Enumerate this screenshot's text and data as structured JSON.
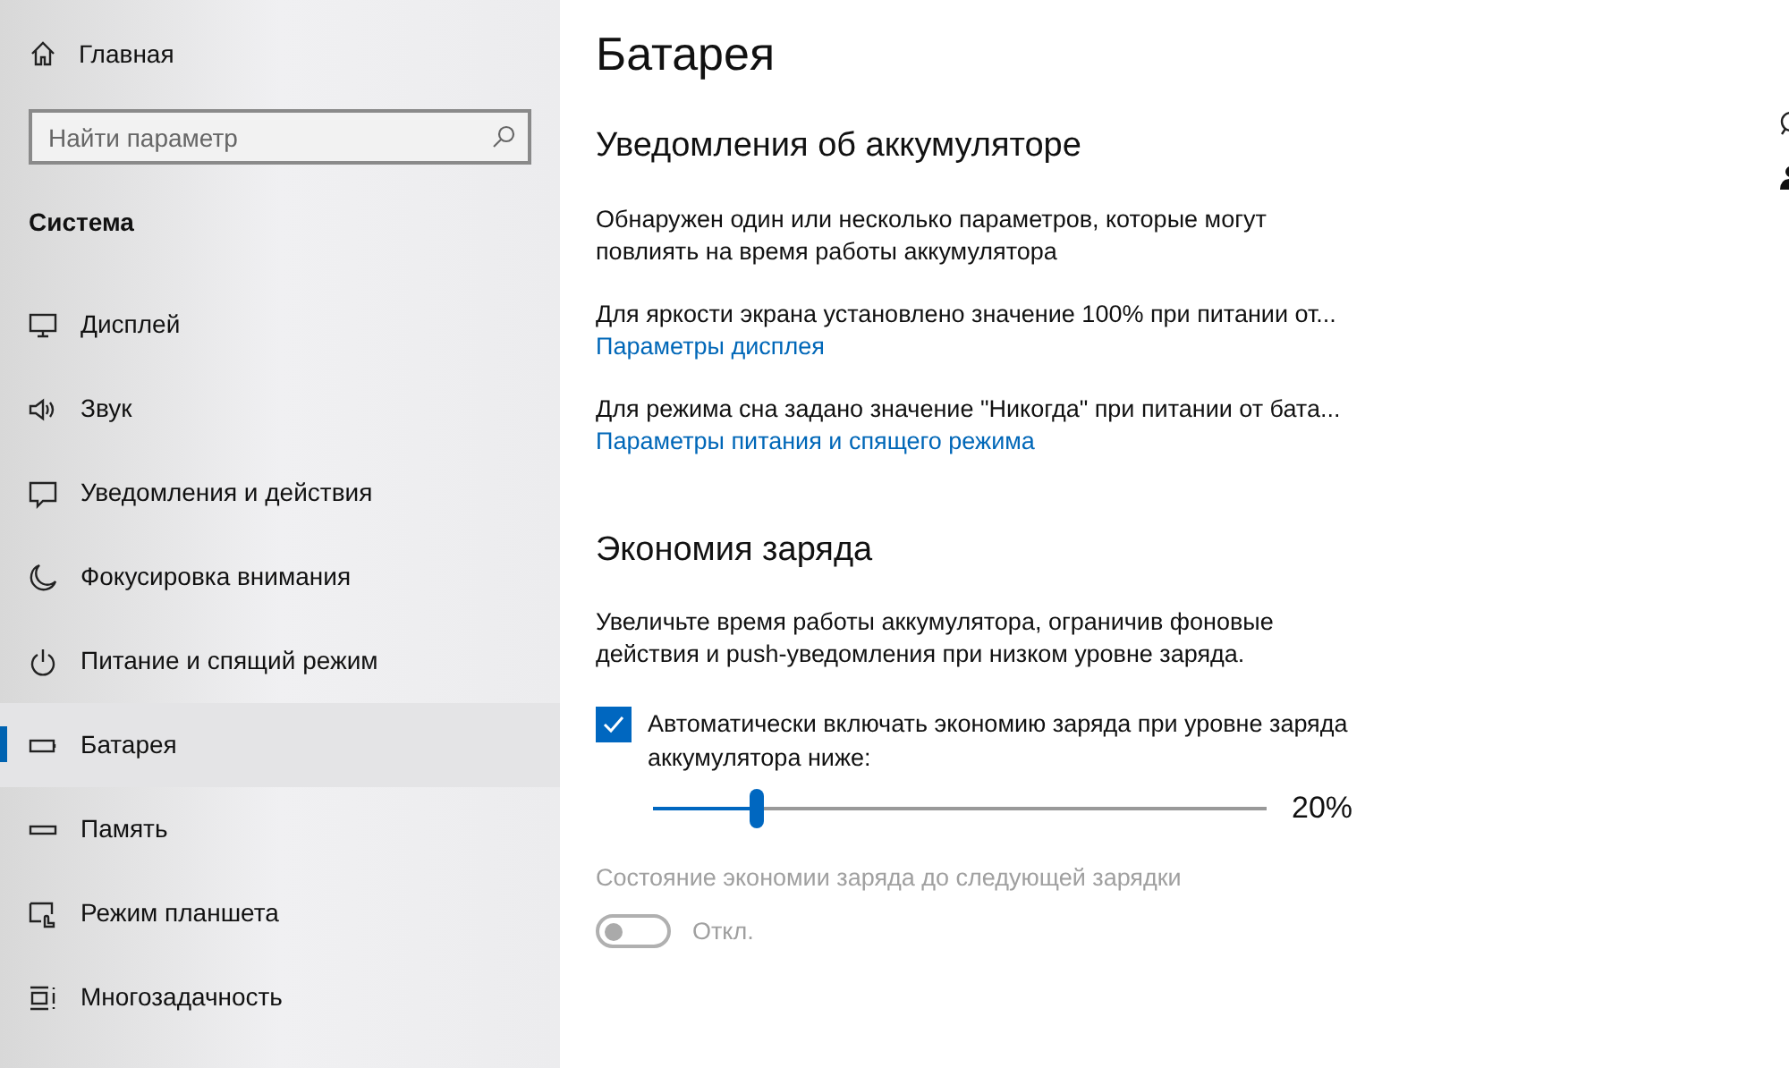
{
  "sidebar": {
    "home": "Главная",
    "search": {
      "placeholder": "Найти параметр"
    },
    "section": "Система",
    "items": [
      {
        "label": "Дисплей",
        "kind": "display",
        "selected": false
      },
      {
        "label": "Звук",
        "kind": "sound",
        "selected": false
      },
      {
        "label": "Уведомления и действия",
        "kind": "notify",
        "selected": false
      },
      {
        "label": "Фокусировка внимания",
        "kind": "moon",
        "selected": false
      },
      {
        "label": "Питание и спящий режим",
        "kind": "power",
        "selected": false
      },
      {
        "label": "Батарея",
        "kind": "battery",
        "selected": true
      },
      {
        "label": "Память",
        "kind": "storage",
        "selected": false
      },
      {
        "label": "Режим планшета",
        "kind": "tablet",
        "selected": false
      },
      {
        "label": "Многозадачность",
        "kind": "multitask",
        "selected": false
      }
    ]
  },
  "page": {
    "title": "Батарея",
    "notifications": {
      "heading": "Уведомления об аккумуляторе",
      "intro": "Обнаружен один или несколько параметров, которые могут повлиять на время работы аккумулятора",
      "items": [
        {
          "text": "Для яркости экрана установлено значение 100% при питании от...",
          "link": "Параметры дисплея"
        },
        {
          "text": "Для режима сна задано значение \"Никогда\" при питании от бата...",
          "link": "Параметры питания и спящего режима"
        }
      ]
    },
    "saver": {
      "heading": "Экономия заряда",
      "description": "Увеличьте время работы аккумулятора, ограничив фоновые действия и push-уведомления при низком уровне заряда.",
      "auto": {
        "label": "Автоматически включать экономию заряда при уровне заряда аккумулятора ниже:",
        "checked": true
      },
      "slider": {
        "level": 0.17,
        "reading": "20%"
      },
      "status": {
        "label": "Состояние экономии заряда до следующей зарядки",
        "on": false,
        "disabled": true,
        "state_text": "Откл."
      }
    }
  }
}
